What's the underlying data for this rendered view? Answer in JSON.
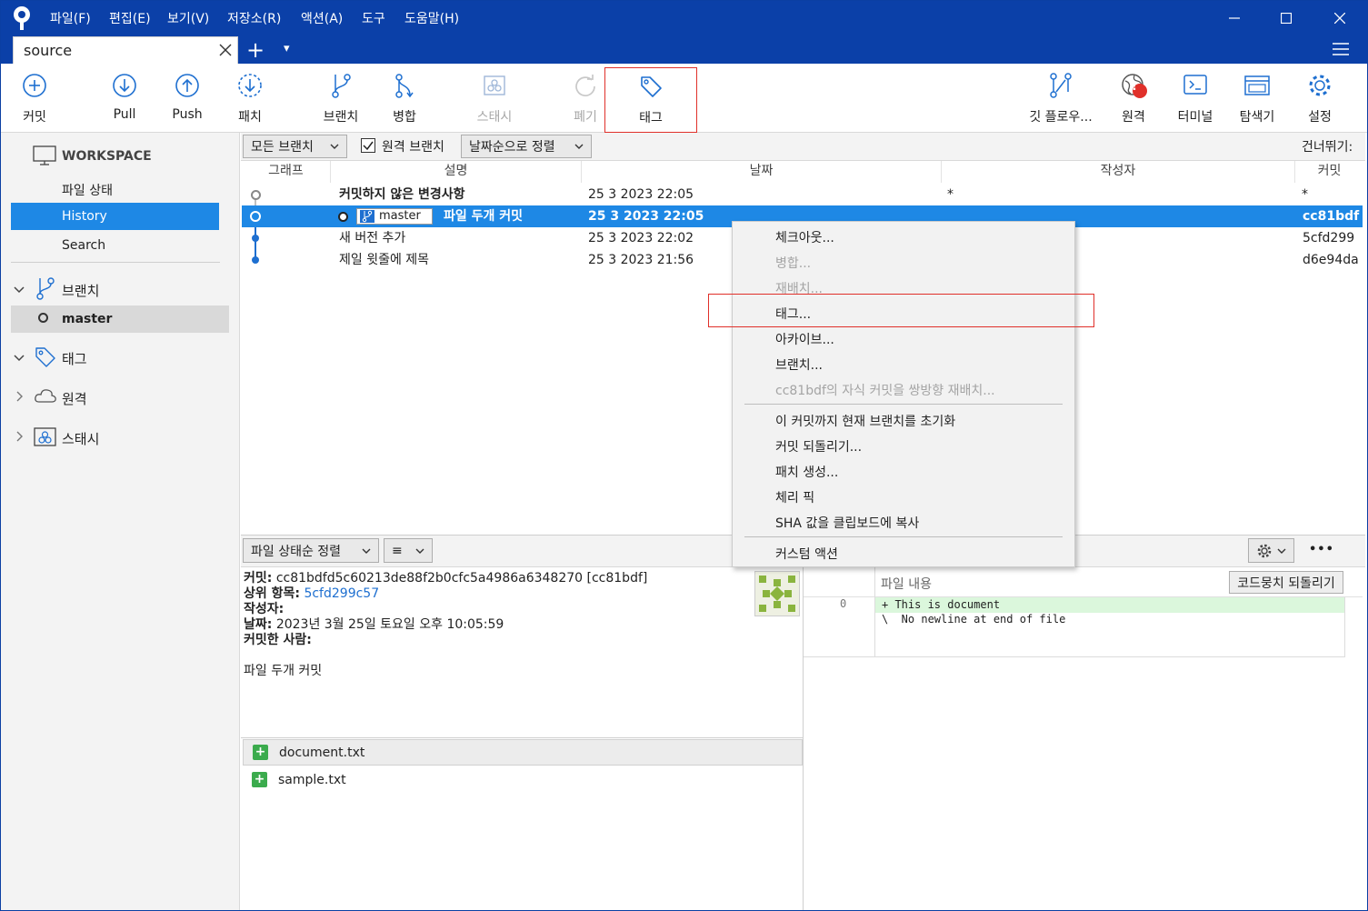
{
  "titlebar": {
    "menus": [
      "파일(F)",
      "편집(E)",
      "보기(V)",
      "저장소(R)",
      "액션(A)",
      "도구",
      "도움말(H)"
    ]
  },
  "tabs": {
    "active": "source",
    "add": "+",
    "dropdown": "▾"
  },
  "toolbar": {
    "commit": "커밋",
    "pull": "Pull",
    "push": "Push",
    "fetch": "패치",
    "branch": "브랜치",
    "merge": "병합",
    "stash": "스태시",
    "discard": "폐기",
    "tag": "태그",
    "gitflow": "깃 플로우...",
    "remote": "원격",
    "terminal": "터미널",
    "explorer": "탐색기",
    "settings": "설정",
    "remote_badge": "!"
  },
  "sidebar": {
    "workspace": "WORKSPACE",
    "file_status": "파일 상태",
    "history": "History",
    "search": "Search",
    "branches": "브랜치",
    "branch_master": "master",
    "tags": "태그",
    "remotes": "원격",
    "stashes": "스태시"
  },
  "filters": {
    "branches": "모든 브랜치",
    "remote_branches": "원격 브랜치",
    "remote_checked": true,
    "sort": "날짜순으로 정렬",
    "skip": "건너뛰기:"
  },
  "columns": [
    "그래프",
    "설명",
    "날짜",
    "작성자",
    "커밋"
  ],
  "commits": [
    {
      "desc": "커밋하지 않은 변경사항",
      "date": "25 3 2023 22:05",
      "author": "*",
      "hash": "*",
      "bold": true,
      "branch": ""
    },
    {
      "desc": "파일 두개 커밋",
      "date": "25 3 2023 22:05",
      "author": "",
      "hash": "cc81bdf",
      "bold": true,
      "branch": "master"
    },
    {
      "desc": "새 버전 추가",
      "date": "25 3 2023 22:02",
      "author": "",
      "hash": "5cfd299",
      "bold": false,
      "branch": ""
    },
    {
      "desc": "제일 윗줄에 제목",
      "date": "25 3 2023 21:56",
      "author": "",
      "hash": "d6e94da",
      "bold": false,
      "branch": ""
    }
  ],
  "context_menu": {
    "checkout": "체크아웃...",
    "merge": "병합...",
    "rebase": "재배치...",
    "tag": "태그...",
    "archive": "아카이브...",
    "branch": "브랜치...",
    "rebase_children": "cc81bdf의 자식 커밋을 쌍방향 재배치...",
    "reset": "이 커밋까지 현재 브랜치를 초기화",
    "revert": "커밋 되돌리기...",
    "patch": "패치 생성...",
    "cherry_pick": "체리 픽",
    "copy_sha": "SHA 값을 클립보드에 복사",
    "custom": "커스텀 액션"
  },
  "bottom": {
    "sort": "파일 상태순 정렬",
    "view_icon": "≡",
    "more": "•••",
    "commit_label": "커밋:",
    "commit_value": "cc81bdfd5c60213de88f2b0cfc5a4986a6348270 [cc81bdf]",
    "parent_label": "상위 항목:",
    "parent_value": "5cfd299c57",
    "author_label": "작성자:",
    "date_label": "날짜:",
    "date_value": "2023년 3월 25일 토요일 오후 10:05:59",
    "committer_label": "커밋한 사람:",
    "message": "파일 두개 커밋",
    "files": [
      "document.txt",
      "sample.txt"
    ]
  },
  "diff": {
    "header": "파일 내용",
    "revert_hunk": "코드뭉치 되돌리기",
    "line_no": "0",
    "line1": "+ This is document",
    "line2": "\\  No newline at end of file"
  },
  "colors": {
    "title_blue": "#0b40a8",
    "selection": "#1e88e5",
    "highlight_red": "#e0302a"
  }
}
